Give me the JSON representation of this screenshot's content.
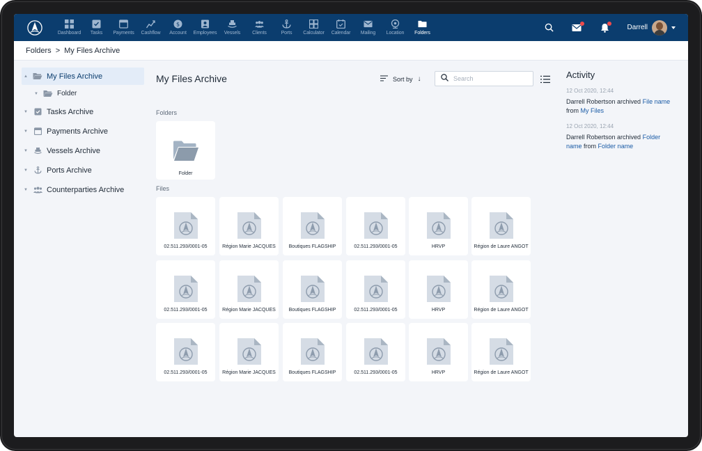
{
  "nav": {
    "items": [
      {
        "label": "Dashboard",
        "icon": "dashboard-icon"
      },
      {
        "label": "Tasks",
        "icon": "tasks-icon"
      },
      {
        "label": "Payments",
        "icon": "payments-icon"
      },
      {
        "label": "Cashflow",
        "icon": "cashflow-icon"
      },
      {
        "label": "Account",
        "icon": "account-icon"
      },
      {
        "label": "Employees",
        "icon": "employees-icon"
      },
      {
        "label": "Vessels",
        "icon": "vessels-icon"
      },
      {
        "label": "Clients",
        "icon": "clients-icon"
      },
      {
        "label": "Ports",
        "icon": "ports-icon"
      },
      {
        "label": "Calculator",
        "icon": "calculator-icon"
      },
      {
        "label": "Calendar",
        "icon": "calendar-icon"
      },
      {
        "label": "Mailing",
        "icon": "mailing-icon"
      },
      {
        "label": "Location",
        "icon": "location-icon"
      },
      {
        "label": "Folders",
        "icon": "folders-icon"
      }
    ],
    "active": "Folders",
    "user_name": "Darrell",
    "accent_color": "#0b3d6e"
  },
  "breadcrumb": {
    "root": "Folders",
    "separator": ">",
    "current": "My Files Archive"
  },
  "sidebar": {
    "items": [
      {
        "label": "My Files Archive",
        "expanded": true,
        "active": true
      },
      {
        "label": "Folder"
      },
      {
        "label": "Tasks Archive"
      },
      {
        "label": "Payments Archive"
      },
      {
        "label": "Vessels Archive"
      },
      {
        "label": "Ports Archive"
      },
      {
        "label": "Counterparties Archive"
      }
    ]
  },
  "main": {
    "title": "My Files Archive",
    "sort_label": "Sort by",
    "search_placeholder": "Search",
    "folders_label": "Folders",
    "files_label": "Files",
    "folders": [
      {
        "name": "Folder"
      }
    ],
    "files": [
      "02.511.293/0001-05",
      "Région Marie JACQUES",
      "Boutiques FLAGSHIP",
      "02.511.293/0001-05",
      "HRVP",
      "Région de Laure ANGOT",
      "02.511.293/0001-05",
      "Région Marie JACQUES",
      "Boutiques FLAGSHIP",
      "02.511.293/0001-05",
      "HRVP",
      "Région de Laure ANGOT",
      "02.511.293/0001-05",
      "Région Marie JACQUES",
      "Boutiques FLAGSHIP",
      "02.511.293/0001-05",
      "HRVP",
      "Région de Laure ANGOT"
    ]
  },
  "activity": {
    "title": "Activity",
    "entries": [
      {
        "date": "12 Oct 2020, 12:44",
        "actor": "Darrell Robertson",
        "verb": "archived",
        "item": "File name",
        "prep": "from",
        "target": "My Files"
      },
      {
        "date": "12 Oct 2020, 12:44",
        "actor": "Darrell Robertson",
        "verb": "archived",
        "item": "Folder name",
        "prep": "from",
        "target": "Folder name"
      }
    ]
  }
}
